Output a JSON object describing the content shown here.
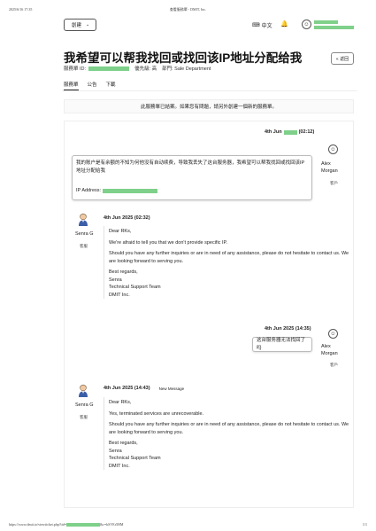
{
  "print": {
    "date": "2025/6/16 17:35",
    "title": "查看服務單 - DMIT, Inc.",
    "url_prefix": "https://www.dmit.io/viewticket.php?tid=",
    "url_suffix": "&c=kSVEr5HM",
    "page_num": "1/1"
  },
  "topbar": {
    "new_label": "創建",
    "lang_label": "中文"
  },
  "ticket": {
    "title": "我希望可以帮我找回或找回该IP地址分配给我",
    "id_label": "服務單 ID:",
    "priority_label": "優先級: 高",
    "dept_label": "部門: Sale Department",
    "back_label": "« 返回"
  },
  "tabs": [
    {
      "label": "服務單"
    },
    {
      "label": "公告"
    },
    {
      "label": "下載"
    }
  ],
  "notice": "此服務單已結案。如果您有問題，請另外創建一個新的服務單。",
  "messages": {
    "m1": {
      "date": "4th Jun",
      "time": "(02:12)",
      "body": "我的账户是有余额的不知为何他没有自动续费，导致我丢失了这台服务器，我希望可以帮我找回或找回该IP地址分配给我",
      "ip_label": "IP Address:",
      "author": "Alex Morgan",
      "role": "客戶"
    },
    "m2": {
      "datetime": "4th Jun 2025 (02:32)",
      "author": "Senra G",
      "role": "客服",
      "lines": [
        "Dear RKs,",
        "We're afraid to tell you that we don't provide specific IP.",
        "Should you have any further inquiries or are in need of any assistance, please do not hesitate to contact us. We are looking forward to serving you.",
        "Best regards,",
        "Senra",
        "Technical Support Team",
        "DMIT Inc."
      ]
    },
    "m3": {
      "datetime": "4th Jun 2025 (14:35)",
      "body": "这台服务器无法找回了吗",
      "author": "Alex Morgan",
      "role": "客戶"
    },
    "m4": {
      "datetime": "4th Jun 2025 (14:43)",
      "new_label": "New Message",
      "author": "Senra G",
      "role": "客服",
      "lines": [
        "Dear RKs,",
        "Yes, terminated services are unrecoverable.",
        "Should you have any further inquiries or are in need of any assistance, please do not hesitate to contact us. We are looking forward to serving you.",
        "Best regards,",
        "Senra",
        "Technical Support Team",
        "DMIT Inc."
      ]
    }
  }
}
